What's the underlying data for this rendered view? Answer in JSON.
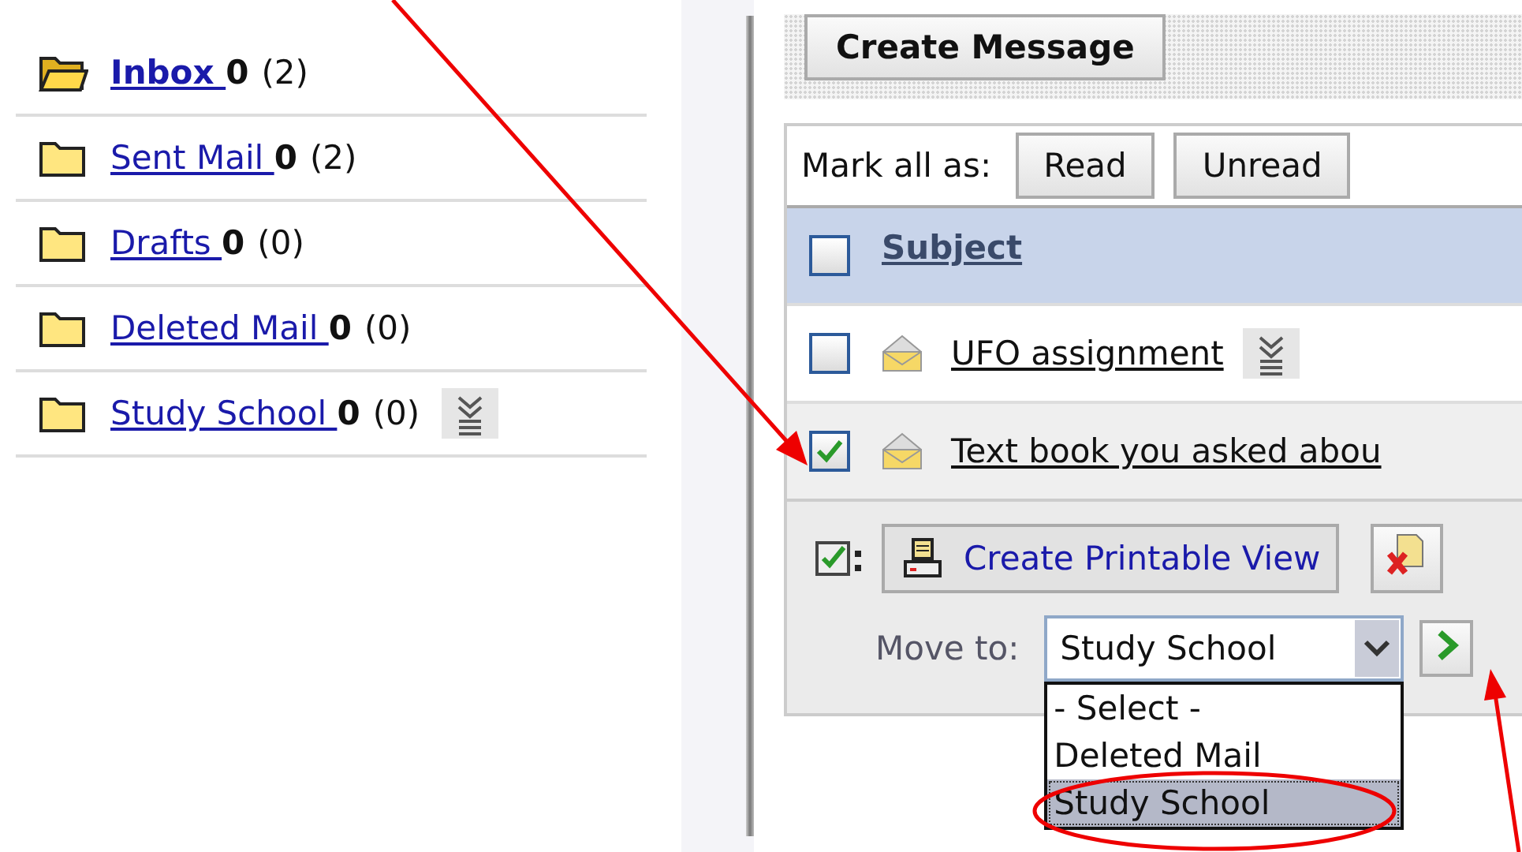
{
  "folders": [
    {
      "name": "Inbox ",
      "unread": "0",
      "total": "(2)",
      "selected": true,
      "has_menu": false
    },
    {
      "name": "Sent Mail ",
      "unread": "0",
      "total": "(2)",
      "selected": false,
      "has_menu": false
    },
    {
      "name": "Drafts ",
      "unread": "0",
      "total": "(0)",
      "selected": false,
      "has_menu": false
    },
    {
      "name": "Deleted Mail ",
      "unread": "0",
      "total": "(0)",
      "selected": false,
      "has_menu": false
    },
    {
      "name": "Study School ",
      "unread": "0",
      "total": "(0)",
      "selected": false,
      "has_menu": true
    }
  ],
  "toolbar": {
    "create_button": "Create Message"
  },
  "mark_all": {
    "label": "Mark all as:",
    "buttons": [
      "Read",
      "Unread"
    ]
  },
  "messages": {
    "header": {
      "label": "Subject",
      "checked": false
    },
    "rows": [
      {
        "subject": "UFO assignment",
        "checked": false,
        "has_menu": true
      },
      {
        "subject": "Text book you asked abou",
        "checked": true,
        "has_menu": false
      }
    ]
  },
  "actions": {
    "print_button": "Create Printable View",
    "move_label": "Move to:",
    "move_value": "Study School",
    "options": [
      {
        "label": "- Select -",
        "selected": false
      },
      {
        "label": "Deleted Mail",
        "selected": false
      },
      {
        "label": "Study School",
        "selected": true
      }
    ]
  }
}
